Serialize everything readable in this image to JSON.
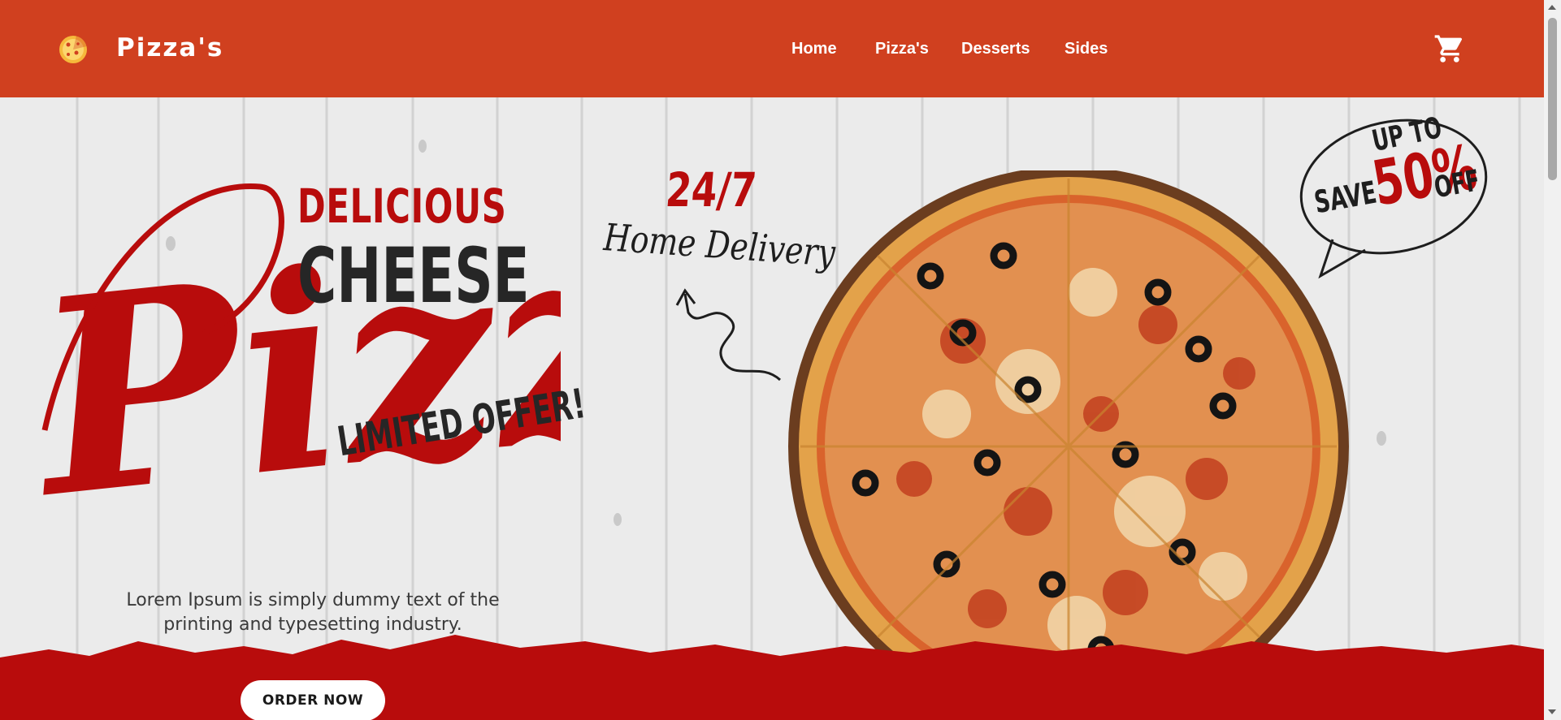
{
  "colors": {
    "navbar": "#d0401f",
    "accent_red": "#b80c0c",
    "dark": "#262626"
  },
  "navbar": {
    "logo_icon": "pizza-logo-icon",
    "brand": "Pizza's",
    "links": [
      "Home",
      "Pizza's",
      "Desserts",
      "Sides"
    ],
    "cart_icon": "cart-icon"
  },
  "hero": {
    "headline_top": "DELICIOUS",
    "headline_mid": "CHEESE",
    "headline_script": "Pizza",
    "limited_offer": "LIMITED OFFER!",
    "delivery_hours": "24/7",
    "delivery_text": "Home Delivery",
    "badge": {
      "up_to": "UP TO",
      "save": "SAVE",
      "percent": "50%",
      "off": "OFF"
    },
    "tagline": "Lorem Ipsum is simply dummy text of the printing and typesetting industry.",
    "cta": "ORDER NOW"
  }
}
